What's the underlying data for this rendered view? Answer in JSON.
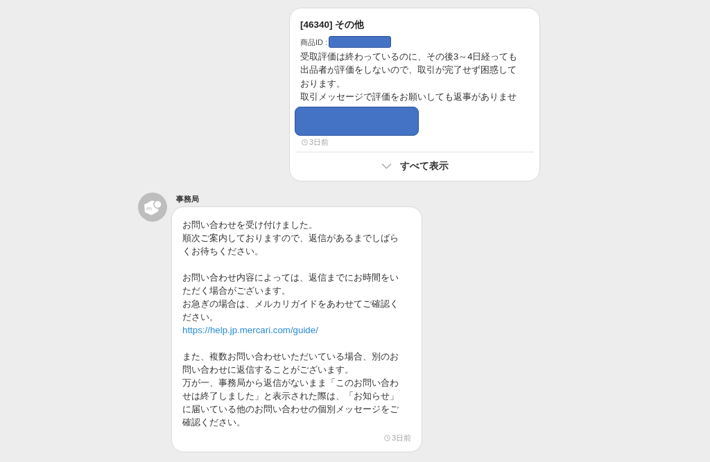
{
  "inquiry": {
    "title": "[46340] その他",
    "product_id": {
      "label": "商品ID :",
      "redacted": true
    },
    "body_lines": [
      "受取評価は終わっているのに、その後3～4日経っても出品者が評価をしないので、取引が完了せず困惑しております。",
      "取引メッセージで評価をお願いしても返事がありませ"
    ],
    "body_redacted": true,
    "time": "3日前",
    "show_all": {
      "label": "すべて表示"
    }
  },
  "reply": {
    "sender": "事務局",
    "paragraphs": [
      {
        "lines": [
          "お問い合わせを受け付けました。",
          "順次ご案内しておりますので、返信があるまでしばらくお待ちください。"
        ]
      },
      {
        "lines": [
          "お問い合わせ内容によっては、返信までにお時間をいただく場合がございます。",
          "お急ぎの場合は、メルカリガイドをあわせてご確認ください。"
        ],
        "link": "https://help.jp.mercari.com/guide/"
      },
      {
        "lines": [
          "また、複数お問い合わせいただいている場合、別のお問い合わせに返信することがございます。",
          "万が一、事務局から返信がないまま「このお問い合わせは終了しました」と表示された際は、「お知らせ」に届いている他のお問い合わせの個別メッセージをご確認ください。"
        ]
      }
    ],
    "time": "3日前"
  }
}
